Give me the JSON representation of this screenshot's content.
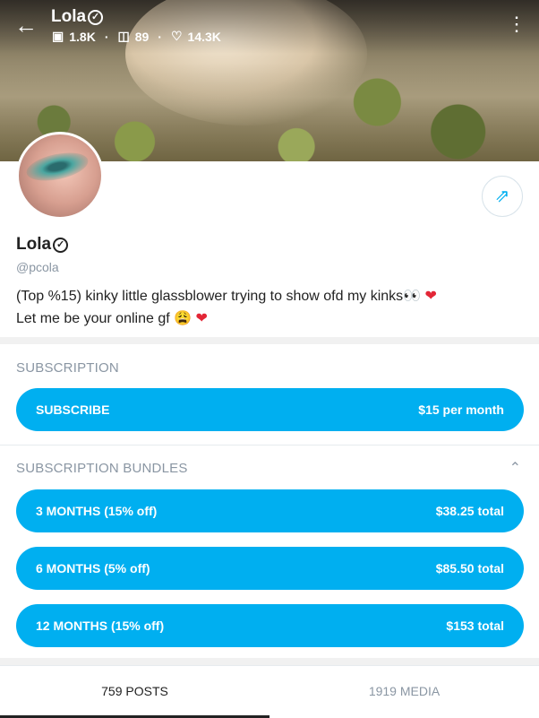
{
  "header": {
    "name": "Lola",
    "stats": {
      "photos": "1.8K",
      "videos": "89",
      "likes": "14.3K"
    },
    "icons": [
      "back-arrow-icon",
      "image-icon",
      "video-icon",
      "heart-icon",
      "kebab-menu-icon"
    ]
  },
  "profile": {
    "name": "Lola",
    "handle": "@pcola",
    "bio_line1": "(Top %15) kinky little glassblower trying to show ofd my kinks👀",
    "bio_line1_heart": "❤",
    "bio_line2": "Let me be your online gf 😩",
    "bio_line2_heart": "❤"
  },
  "subscription": {
    "title": "SUBSCRIPTION",
    "button_label": "SUBSCRIBE",
    "button_price": "$15 per month"
  },
  "bundles": {
    "title": "SUBSCRIPTION BUNDLES",
    "items": [
      {
        "label": "3 MONTHS (15% off)",
        "price": "$38.25 total"
      },
      {
        "label": "6 MONTHS (5% off)",
        "price": "$85.50 total"
      },
      {
        "label": "12 MONTHS (15% off)",
        "price": "$153 total"
      }
    ]
  },
  "tabs": [
    {
      "label": "759 POSTS",
      "active": true
    },
    {
      "label": "1919 MEDIA",
      "active": false
    }
  ],
  "colors": {
    "accent": "#00aff0",
    "muted": "#8a96a3",
    "text": "#222222"
  }
}
